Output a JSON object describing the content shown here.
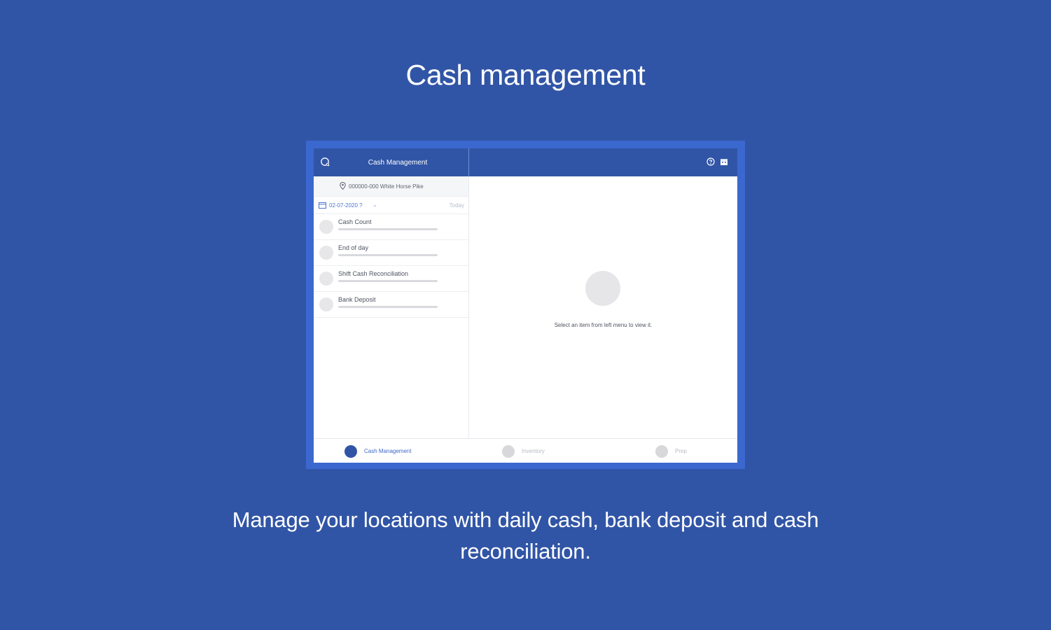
{
  "hero": {
    "title": "Cash management",
    "subtitle_line1": "Manage your locations with daily cash, bank deposit and cash",
    "subtitle_line2": "reconciliation."
  },
  "app": {
    "header_title": "Cash Management",
    "location": "000000-000 White Horse Pike",
    "date": "02-07-2020 ?",
    "today_label": "Today",
    "menu_items": [
      {
        "label": "Cash Count"
      },
      {
        "label": "End of day"
      },
      {
        "label": "Shift Cash Reconciliation"
      },
      {
        "label": "Bank Deposit"
      }
    ],
    "empty_message": "Select an item from left menu to view it.",
    "bottom_nav": [
      {
        "label": "Cash Management",
        "active": true
      },
      {
        "label": "Inventory",
        "active": false
      },
      {
        "label": "Prep",
        "active": false
      }
    ]
  },
  "colors": {
    "background": "#3155a6",
    "device_frame": "#3b68cf",
    "header": "#3155a6",
    "active_nav": "#3e68c8"
  },
  "icons": [
    "refresh-icon",
    "help-icon",
    "calendar-icon",
    "pin-icon",
    "date-calendar-icon"
  ]
}
